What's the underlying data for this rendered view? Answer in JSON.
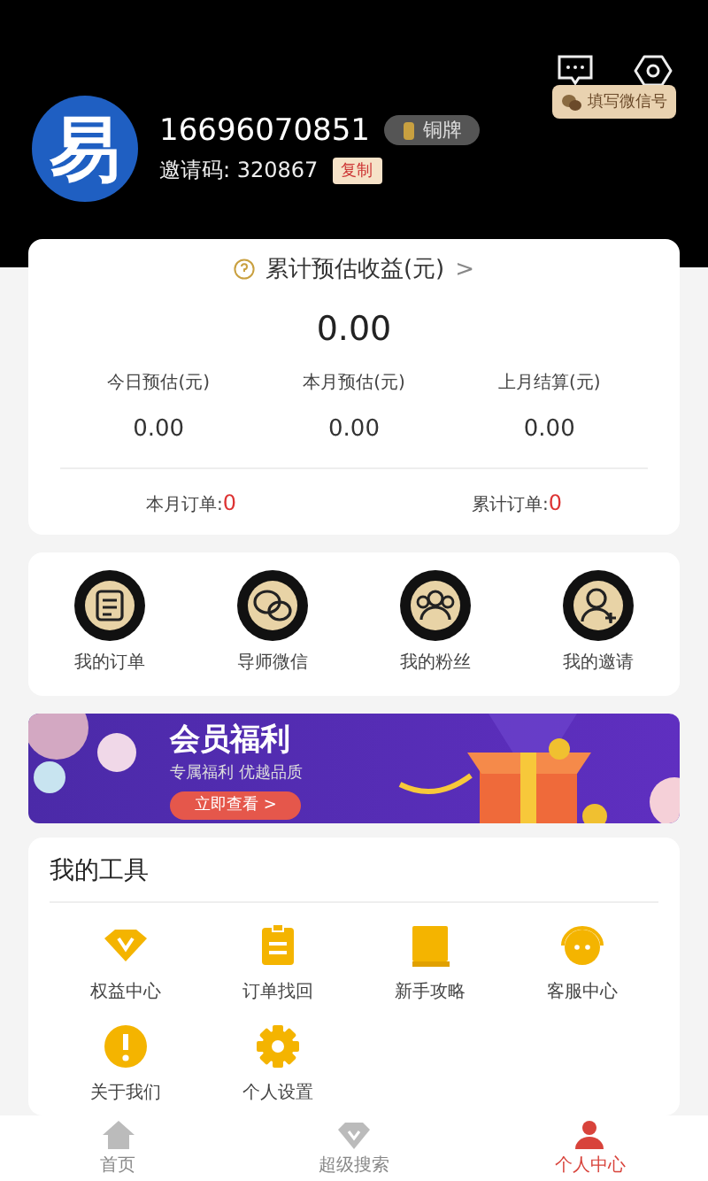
{
  "profile": {
    "avatar_text": "易",
    "phone": "16696070851",
    "badge": "铜牌",
    "invite_label": "邀请码: 320867",
    "copy_button": "复制",
    "wechat_button": "填写微信号"
  },
  "earnings": {
    "title": "累计预估收益(元)",
    "arrow": ">",
    "total": "0.00",
    "stats": [
      {
        "label": "今日预估(元)",
        "value": "0.00"
      },
      {
        "label": "本月预估(元)",
        "value": "0.00"
      },
      {
        "label": "上月结算(元)",
        "value": "0.00"
      }
    ],
    "orders": [
      {
        "label": "本月订单:",
        "value": "0"
      },
      {
        "label": "累计订单:",
        "value": "0"
      }
    ]
  },
  "shortcuts": [
    {
      "kind": "order",
      "label": "我的订单"
    },
    {
      "kind": "wechat",
      "label": "导师微信"
    },
    {
      "kind": "fans",
      "label": "我的粉丝"
    },
    {
      "kind": "invite",
      "label": "我的邀请"
    }
  ],
  "banner": {
    "title": "会员福利",
    "subtitle": "专属福利 优越品质",
    "button": "立即查看 >"
  },
  "tools": {
    "title": "我的工具",
    "items": [
      {
        "kind": "vip",
        "label": "权益中心"
      },
      {
        "kind": "clipboard",
        "label": "订单找回"
      },
      {
        "kind": "book",
        "label": "新手攻略"
      },
      {
        "kind": "service",
        "label": "客服中心"
      },
      {
        "kind": "info",
        "label": "关于我们"
      },
      {
        "kind": "gear",
        "label": "个人设置"
      }
    ]
  },
  "nav": [
    {
      "kind": "home",
      "label": "首页",
      "selected": false
    },
    {
      "kind": "diamond",
      "label": "超级搜索",
      "selected": false
    },
    {
      "kind": "person",
      "label": "个人中心",
      "selected": true
    }
  ]
}
